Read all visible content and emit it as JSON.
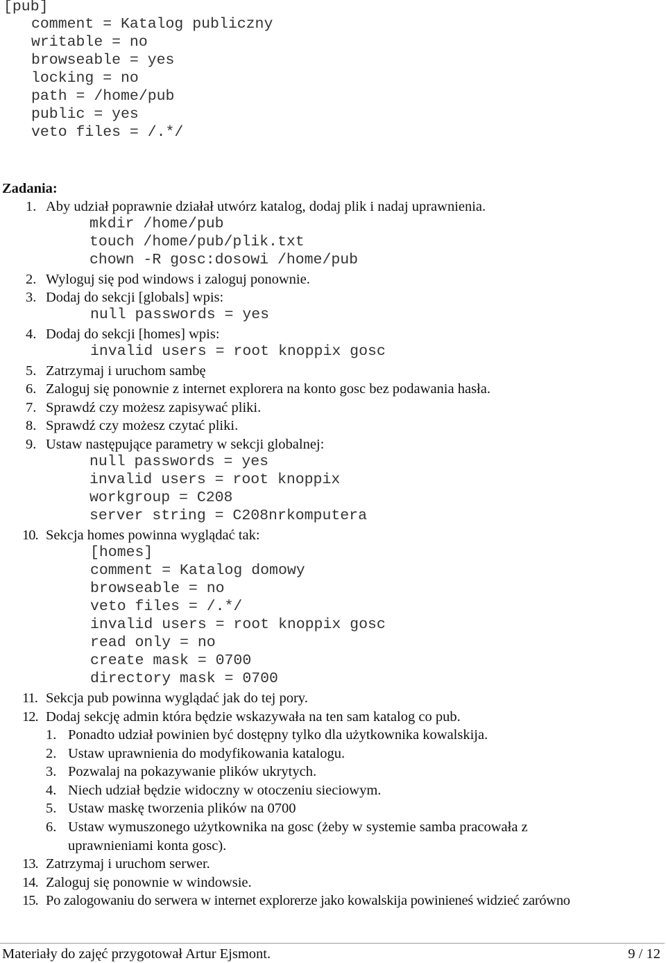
{
  "config_block": {
    "header": "[pub]",
    "lines": [
      "comment = Katalog publiczny",
      "writable = no",
      "browseable = yes",
      "locking = no",
      "path = /home/pub",
      "public = yes",
      "veto files = /.*/"
    ]
  },
  "tasks": {
    "heading": "Zadania:",
    "items": [
      {
        "num": "1.",
        "text": "Aby udział poprawnie działał utwórz katalog, dodaj plik i nadaj uprawnienia.",
        "code": [
          "mkdir /home/pub",
          "touch /home/pub/plik.txt",
          "chown -R gosc:dosowi /home/pub"
        ]
      },
      {
        "num": "2.",
        "text": "Wyloguj się pod windows i zaloguj ponownie."
      },
      {
        "num": "3.",
        "text": "Dodaj do sekcji [globals] wpis:",
        "code": [
          "null passwords = yes"
        ]
      },
      {
        "num": "4.",
        "text": "Dodaj do sekcji [homes] wpis:",
        "code": [
          "invalid users = root knoppix gosc"
        ]
      },
      {
        "num": "5.",
        "text": "Zatrzymaj i uruchom sambę"
      },
      {
        "num": "6.",
        "text": "Zaloguj się ponownie z internet explorera na konto gosc bez podawania hasła."
      },
      {
        "num": "7.",
        "text": "Sprawdź czy możesz zapisywać pliki."
      },
      {
        "num": "8.",
        "text": "Sprawdź czy możesz czytać pliki."
      },
      {
        "num": "9.",
        "text": "Ustaw następujące parametry w sekcji globalnej:",
        "code": [
          "null passwords = yes",
          "invalid users = root knoppix",
          "workgroup = C208",
          "server string = C208nrkomputera"
        ]
      },
      {
        "num": "10.",
        "text": "Sekcja homes powinna wyglądać tak:",
        "code": [
          "[homes]",
          "comment = Katalog domowy",
          "browseable = no",
          "veto files = /.*/",
          "invalid users = root knoppix gosc",
          "read only = no",
          "create mask = 0700",
          "directory mask = 0700"
        ]
      },
      {
        "num": "11.",
        "text": "Sekcja pub powinna wyglądać jak do tej pory."
      },
      {
        "num": "12.",
        "text": "Dodaj sekcję admin która będzie wskazywała na ten sam katalog co pub.",
        "subitems": [
          {
            "num": "1.",
            "text": "Ponadto udział powinien być dostępny tylko dla użytkownika kowalskija."
          },
          {
            "num": "2.",
            "text": "Ustaw uprawnienia do modyfikowania katalogu."
          },
          {
            "num": "3.",
            "text": "Pozwalaj na pokazywanie plików ukrytych."
          },
          {
            "num": "4.",
            "text": "Niech udział będzie widoczny w otoczeniu sieciowym."
          },
          {
            "num": "5.",
            "text": "Ustaw maskę tworzenia plików na 0700"
          },
          {
            "num": "6.",
            "text": "Ustaw wymuszonego użytkownika na gosc (żeby w systemie samba pracowała z",
            "text_cont": "uprawnieniami konta gosc)."
          }
        ]
      },
      {
        "num": "13.",
        "text": "Zatrzymaj i uruchom serwer."
      },
      {
        "num": "14.",
        "text": "Zaloguj się ponownie w windowsie."
      },
      {
        "num": "15.",
        "text": "Po zalogowaniu do serwera w internet explorerze jako kowalskija powinieneś widzieć zarówno"
      }
    ]
  },
  "footer": {
    "author_note": "Materiały do zajęć przygotował Artur Ejsmont.",
    "page_indicator": "9 / 12"
  }
}
